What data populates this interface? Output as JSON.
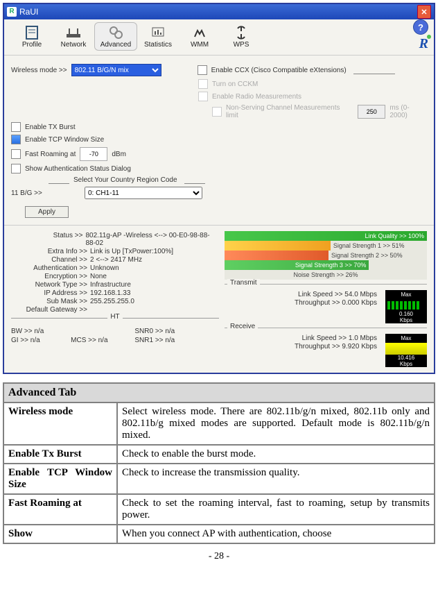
{
  "window": {
    "title": "RaUI"
  },
  "toolbar": {
    "items": [
      {
        "label": "Profile"
      },
      {
        "label": "Network"
      },
      {
        "label": "Advanced"
      },
      {
        "label": "Statistics"
      },
      {
        "label": "WMM"
      },
      {
        "label": "WPS"
      }
    ]
  },
  "adv": {
    "wireless_mode_lbl": "Wireless mode >>",
    "wireless_mode_val": "802.11 B/G/N mix",
    "enable_ccx": "Enable CCX (Cisco Compatible eXtensions)",
    "turn_cckm": "Turn on CCKM",
    "enable_radio": "Enable Radio Measurements",
    "nonserv": "Non-Serving Channel Measurements limit",
    "nonserv_val": "250",
    "nonserv_range": "ms (0-2000)",
    "tx_burst": "Enable TX Burst",
    "tcp_win": "Enable TCP Window Size",
    "fast_roam": "Fast Roaming at",
    "fast_roam_val": "-70",
    "fast_roam_unit": "dBm",
    "show_auth": "Show Authentication Status Dialog",
    "region_lbl": "Select Your Country Region Code",
    "bg_lbl": "11 B/G >>",
    "bg_val": "0: CH1-11",
    "apply": "Apply"
  },
  "status": {
    "status_k": "Status >>",
    "status_v": "802.11g-AP -Wireless  <--> 00-E0-98-88-88-02",
    "extra_k": "Extra Info >>",
    "extra_v": "Link is Up [TxPower:100%]",
    "ch_k": "Channel >>",
    "ch_v": "2 <--> 2417 MHz",
    "auth_k": "Authentication >>",
    "auth_v": "Unknown",
    "enc_k": "Encryption >>",
    "enc_v": "None",
    "net_k": "Network Type >>",
    "net_v": "Infrastructure",
    "ip_k": "IP Address >>",
    "ip_v": "192.168.1.33",
    "mask_k": "Sub Mask >>",
    "mask_v": "255.255.255.0",
    "gw_k": "Default Gateway >>",
    "gw_v": "",
    "ht": "HT",
    "bw_k": "BW >>",
    "bw_v": "n/a",
    "gi_k": "GI >>",
    "gi_v": "n/a",
    "mcs_k": "MCS >>",
    "mcs_v": "n/a",
    "snr0_k": "SNR0 >>",
    "snr0_v": "n/a",
    "snr1_k": "SNR1 >>",
    "snr1_v": "n/a"
  },
  "bars": {
    "link": "Link Quality >> 100%",
    "s1": "Signal Strength 1 >> 51%",
    "s2": "Signal Strength 2 >> 50%",
    "s3": "Signal Strength 3 >> 70%",
    "noise": "Noise Strength >> 26%"
  },
  "tx": {
    "group": "Transmit",
    "ls": "Link Speed >> 54.0 Mbps",
    "tp": "Throughput >> 0.000 Kbps",
    "max": "Max",
    "val": "0.160",
    "unit": "Kbps"
  },
  "rx": {
    "group": "Receive",
    "ls": "Link Speed >> 1.0 Mbps",
    "tp": "Throughput >> 9.920 Kbps",
    "max": "Max",
    "val": "10.416",
    "unit": "Kbps"
  },
  "doc": {
    "header": "Advanced Tab",
    "r1k": "Wireless mode",
    "r1v": "Select wireless mode. There are 802.11b/g/n mixed, 802.11b only and 802.11b/g mixed modes are supported. Default mode is 802.11b/g/n mixed.",
    "r2k": "Enable Tx Burst",
    "r2v": "Check to enable the burst mode.",
    "r3k": "Enable TCP Window Size",
    "r3v": "Check to increase the transmission quality.",
    "r4k": "Fast Roaming at",
    "r4v": "Check to set the roaming interval, fast to roaming, setup by transmits power.",
    "r5k": "Show",
    "r5v": "When you connect AP with authentication, choose"
  },
  "page": "- 28 -"
}
